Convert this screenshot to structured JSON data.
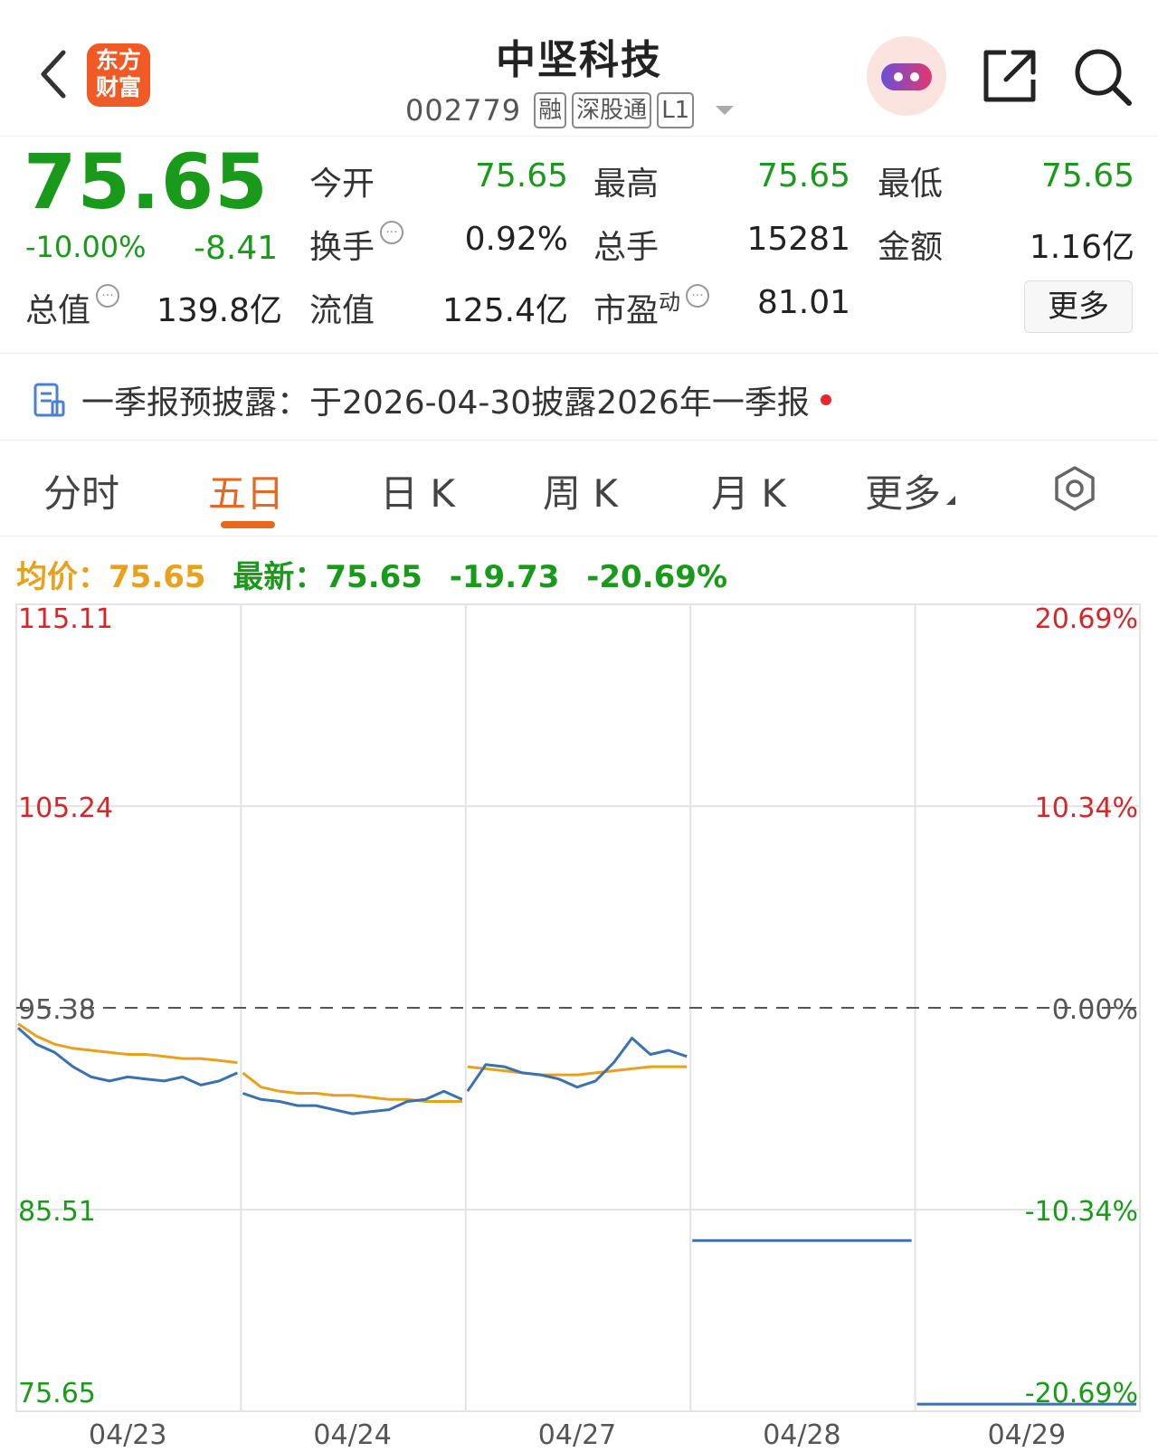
{
  "header": {
    "logo_line1": "东方",
    "logo_line2": "财富",
    "stock_name": "中坚科技",
    "stock_code": "002779",
    "tags": [
      "融",
      "深股通",
      "L1"
    ]
  },
  "quote": {
    "price": "75.65",
    "change_pct": "-10.00%",
    "change_abs": "-8.41",
    "fields": {
      "open_label": "今开",
      "open_value": "75.65",
      "high_label": "最高",
      "high_value": "75.65",
      "low_label": "最低",
      "low_value": "75.65",
      "turnover_label": "换手",
      "turnover_value": "0.92%",
      "volume_label": "总手",
      "volume_value": "15281",
      "amount_label": "金额",
      "amount_value": "1.16亿",
      "mktcap_label": "总值",
      "mktcap_value": "139.8亿",
      "float_label": "流值",
      "float_value": "125.4亿",
      "pe_label": "市盈",
      "pe_superscript": "动",
      "pe_value": "81.01"
    },
    "more_label": "更多"
  },
  "notice": {
    "text": "一季报预披露：于2026-04-30披露2026年一季报"
  },
  "tabs": [
    {
      "label": "分时",
      "active": false
    },
    {
      "label": "五日",
      "active": true
    },
    {
      "label": "日 K",
      "active": false
    },
    {
      "label": "周 K",
      "active": false
    },
    {
      "label": "月 K",
      "active": false
    },
    {
      "label": "更多",
      "active": false
    }
  ],
  "legend": {
    "avg_label": "均价：",
    "avg_value": "75.65",
    "latest_label": "最新：",
    "latest_value": "75.65",
    "latest_change": "-19.73",
    "latest_pct": "-20.69%"
  },
  "colors": {
    "up_red": "#d7262b",
    "down_green": "#1a9a1a",
    "accent_orange": "#e8691e",
    "price_line": "#3a72b0",
    "avg_line": "#e9a11d"
  },
  "chart_data": {
    "type": "line",
    "x": [
      "04/23",
      "04/24",
      "04/27",
      "04/28",
      "04/29"
    ],
    "y_ticks_left": [
      "115.11",
      "105.24",
      "95.38",
      "85.51",
      "75.65"
    ],
    "y_ticks_right": [
      "20.69%",
      "10.34%",
      "0.00%",
      "-10.34%",
      "-20.69%"
    ],
    "ylim": [
      75.65,
      115.11
    ],
    "reference_close": 95.38,
    "series": [
      {
        "name": "最新",
        "values": [
          [
            94.4,
            93.6,
            93.2,
            92.5,
            92.0,
            91.8,
            92.0,
            91.9,
            91.8,
            92.0,
            91.6,
            91.8,
            92.2
          ],
          [
            91.2,
            90.9,
            90.8,
            90.6,
            90.6,
            90.4,
            90.2,
            90.3,
            90.4,
            90.8,
            90.9,
            91.3,
            90.9
          ],
          [
            91.3,
            92.6,
            92.5,
            92.2,
            92.1,
            91.9,
            91.5,
            91.8,
            92.7,
            93.9,
            93.1,
            93.3,
            93.0
          ],
          [
            84.0,
            84.0,
            84.0,
            84.0,
            84.0,
            84.0,
            84.0,
            84.0,
            84.0,
            84.0,
            84.0,
            84.0,
            84.0
          ],
          [
            76.0,
            76.0,
            76.0,
            76.0,
            76.0,
            76.0,
            76.0,
            76.0,
            76.0,
            76.0,
            76.0,
            76.0,
            76.0
          ]
        ]
      },
      {
        "name": "均价",
        "values": [
          [
            94.6,
            94.0,
            93.6,
            93.4,
            93.3,
            93.2,
            93.1,
            93.1,
            93.0,
            92.9,
            92.9,
            92.8,
            92.7
          ],
          [
            92.2,
            91.5,
            91.3,
            91.2,
            91.2,
            91.1,
            91.1,
            91.0,
            90.9,
            90.9,
            90.8,
            90.8,
            90.8
          ],
          [
            92.5,
            92.4,
            92.3,
            92.2,
            92.1,
            92.1,
            92.1,
            92.2,
            92.3,
            92.4,
            92.5,
            92.5,
            92.5
          ],
          [],
          []
        ]
      }
    ]
  }
}
